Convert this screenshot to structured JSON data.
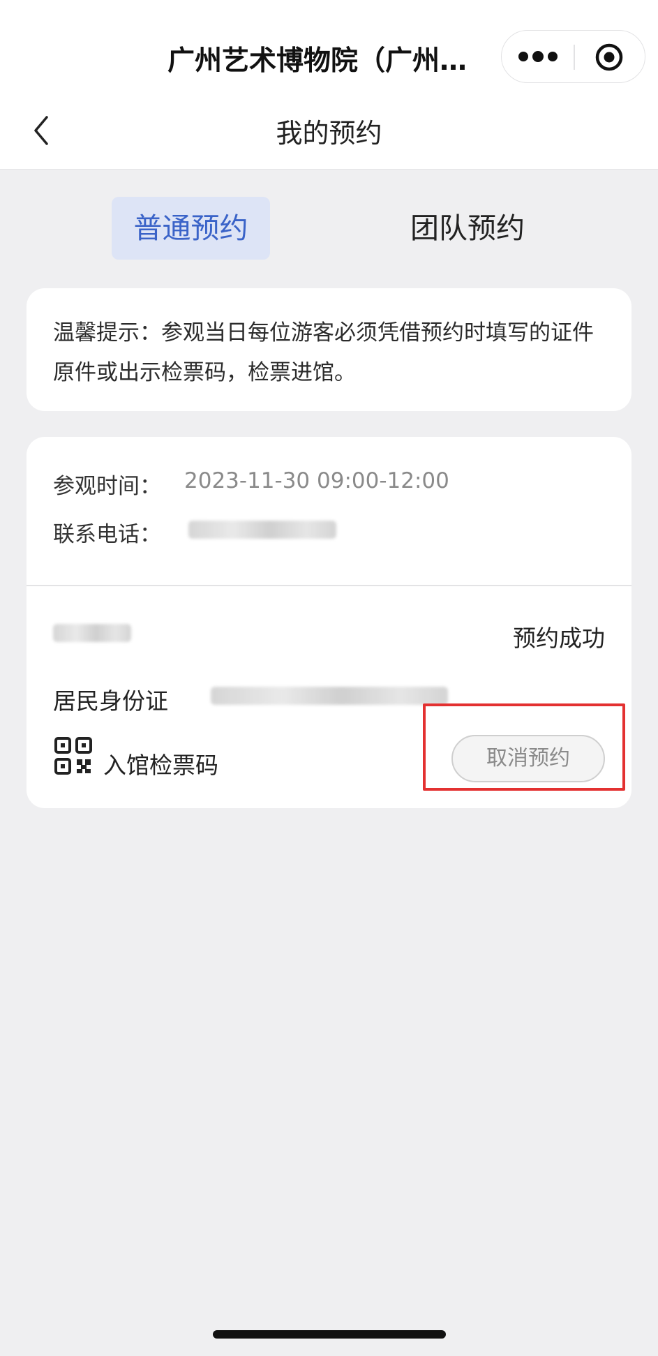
{
  "app": {
    "title": "广州艺术博物院（广州美…",
    "page_title": "我的预约"
  },
  "icons": {
    "more": "more-dots-icon",
    "close": "close-miniprogram-icon",
    "back": "chevron-left-icon",
    "qr": "qr-code-icon"
  },
  "tabs": [
    {
      "label": "普通预约",
      "active": true
    },
    {
      "label": "团队预约",
      "active": false
    }
  ],
  "notice": {
    "text": "温馨提示：参观当日每位游客必须凭借预约时填写的证件原件或出示检票码，检票进馆。"
  },
  "booking": {
    "visit_time_label": "参观时间：",
    "visit_time_value": "2023-11-30 09:00-12:00",
    "phone_label": "联系电话：",
    "status": "预约成功",
    "id_type_label": "居民身份证",
    "qr_label": "入馆检票码",
    "cancel_label": "取消预约"
  },
  "colors": {
    "accent": "#3a63c8",
    "tab_active_bg": "#dde4f6",
    "highlight": "#e33131",
    "background": "#efeff1"
  }
}
